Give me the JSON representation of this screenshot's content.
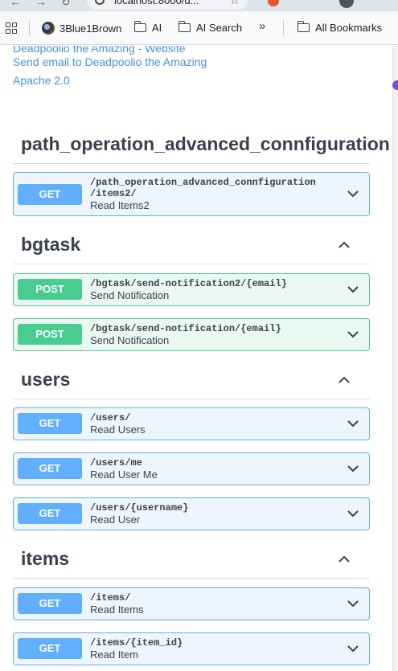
{
  "browser": {
    "url": "localhost:8000/d...",
    "bookmarks": [
      "3Blue1Brown",
      "AI",
      "AI Search",
      "All Bookmarks"
    ],
    "overflow_glyph": "»"
  },
  "info": {
    "website_link": "Deadpoolio the Amazing - Website",
    "email_link": "Send email to Deadpoolio the Amazing",
    "license": "Apache 2.0"
  },
  "sections": [
    {
      "name": "path_operation_advanced_connfiguration",
      "operations": [
        {
          "method": "GET",
          "path_line1": "/path_operation_advanced_connfiguration",
          "path_line2": "/items2/",
          "summary": "Read Items2"
        }
      ]
    },
    {
      "name": "bgtask",
      "operations": [
        {
          "method": "POST",
          "path": "/bgtask/send-notification2/{email}",
          "summary": "Send Notification"
        },
        {
          "method": "POST",
          "path": "/bgtask/send-notification/{email}",
          "summary": "Send Notification"
        }
      ]
    },
    {
      "name": "users",
      "operations": [
        {
          "method": "GET",
          "path": "/users/",
          "summary": "Read Users"
        },
        {
          "method": "GET",
          "path": "/users/me",
          "summary": "Read User Me"
        },
        {
          "method": "GET",
          "path": "/users/{username}",
          "summary": "Read User"
        }
      ]
    },
    {
      "name": "items",
      "operations": [
        {
          "method": "GET",
          "path": "/items/",
          "summary": "Read Items"
        },
        {
          "method": "GET",
          "path": "/items/{item_id}",
          "summary": "Read Item"
        }
      ]
    }
  ],
  "colors": {
    "get": "#61affe",
    "post": "#49cc90",
    "link": "#4990e2",
    "text": "#3b4151"
  },
  "icons": {
    "collapse": "chevron-up-icon",
    "expand": "chevron-down-icon"
  }
}
